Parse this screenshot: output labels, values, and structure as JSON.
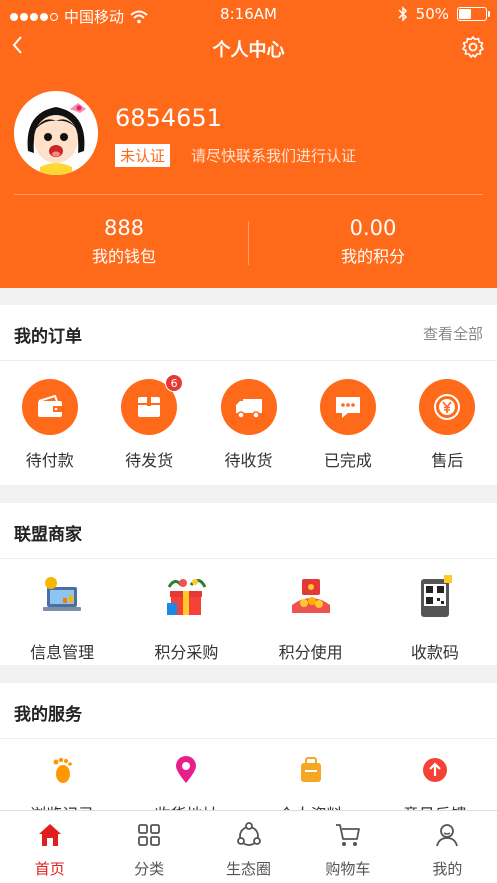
{
  "status_bar": {
    "carrier": "中国移动",
    "time": "8:16AM",
    "battery": "50%",
    "battery_level": 0.5
  },
  "nav": {
    "title": "个人中心"
  },
  "profile": {
    "username": "6854651",
    "verify_badge": "未认证",
    "verify_tip": "请尽快联系我们进行认证"
  },
  "stats": [
    {
      "value": "888",
      "label": "我的钱包"
    },
    {
      "value": "0.00",
      "label": "我的积分"
    }
  ],
  "orders": {
    "title": "我的订单",
    "view_all": "查看全部",
    "items": [
      {
        "label": "待付款",
        "icon": "wallet-icon"
      },
      {
        "label": "待发货",
        "icon": "box-icon",
        "badge": "6"
      },
      {
        "label": "待收货",
        "icon": "truck-icon"
      },
      {
        "label": "已完成",
        "icon": "chat-icon"
      },
      {
        "label": "售后",
        "icon": "yen-icon"
      }
    ]
  },
  "merchants": {
    "title": "联盟商家",
    "items": [
      {
        "label": "信息管理",
        "icon": "info-management-icon"
      },
      {
        "label": "积分采购",
        "icon": "gift-icon"
      },
      {
        "label": "积分使用",
        "icon": "red-packet-icon"
      },
      {
        "label": "收款码",
        "icon": "qr-code-icon"
      }
    ]
  },
  "services": {
    "title": "我的服务",
    "items": [
      {
        "label": "浏览记录",
        "icon": "footprint-icon"
      },
      {
        "label": "收货地址",
        "icon": "location-pin-icon"
      },
      {
        "label": "个人资料",
        "icon": "briefcase-icon"
      },
      {
        "label": "意见反馈",
        "icon": "arrow-up-icon"
      }
    ]
  },
  "tabs": [
    {
      "label": "首页",
      "icon": "home-icon",
      "active": true
    },
    {
      "label": "分类",
      "icon": "grid-icon"
    },
    {
      "label": "生态圈",
      "icon": "circle-network-icon"
    },
    {
      "label": "购物车",
      "icon": "cart-icon"
    },
    {
      "label": "我的",
      "icon": "user-icon"
    }
  ],
  "colors": {
    "brand": "#ff6a1a",
    "tab_active": "#e02020"
  }
}
